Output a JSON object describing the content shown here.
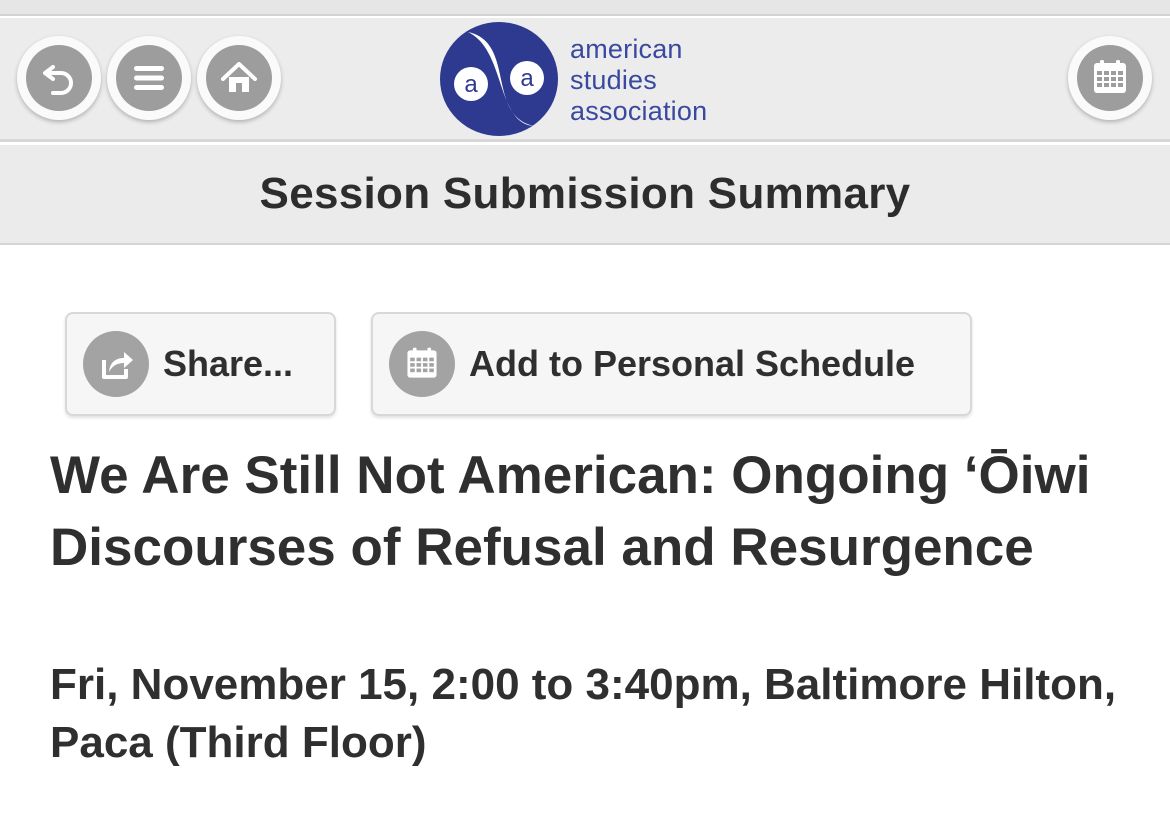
{
  "header": {
    "logo_text_line1": "american",
    "logo_text_line2": "studies",
    "logo_text_line3": "association",
    "logo_mark_left": "a",
    "logo_mark_right": "a",
    "buttons": {
      "back_icon": "back-arrow-icon",
      "menu_icon": "hamburger-menu-icon",
      "home_icon": "home-icon",
      "calendar_icon": "calendar-icon"
    }
  },
  "page": {
    "title": "Session Submission Summary"
  },
  "actions": {
    "share_label": "Share...",
    "share_icon": "share-icon",
    "schedule_label": "Add to Personal Schedule",
    "schedule_icon": "calendar-icon"
  },
  "session": {
    "title": "We Are Still Not American: Ongoing ‘Ōiwi Discourses of Refusal and Resurgence",
    "meta": "Fri, November 15, 2:00 to 3:40pm, Baltimore Hilton, Paca (Third Floor)"
  },
  "colors": {
    "brand": "#2e3a8f",
    "header_bg": "#ececec",
    "icon_gray": "#9d9d9d"
  }
}
